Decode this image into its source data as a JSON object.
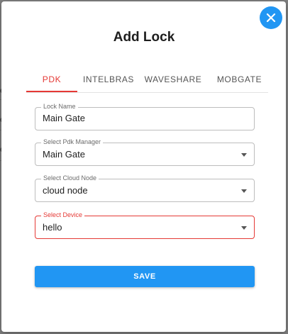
{
  "dialog": {
    "title": "Add Lock",
    "close_icon": "close-icon"
  },
  "background_fragments": [
    "e",
    "e",
    "e"
  ],
  "tabs": [
    {
      "label": "PDK",
      "active": true
    },
    {
      "label": "INTELBRAS",
      "active": false
    },
    {
      "label": "WAVESHARE",
      "active": false
    },
    {
      "label": "MOBGATE",
      "active": false
    }
  ],
  "form": {
    "lock_name": {
      "label": "Lock Name",
      "value": "Main Gate"
    },
    "pdk_manager": {
      "label": "Select Pdk Manager",
      "value": "Main Gate",
      "icon": "chevron-down-icon"
    },
    "cloud_node": {
      "label": "Select Cloud Node",
      "value": "cloud node",
      "icon": "chevron-down-icon"
    },
    "device": {
      "label": "Select Device",
      "value": "hello",
      "icon": "chevron-down-icon",
      "error": true
    }
  },
  "save_label": "SAVE",
  "colors": {
    "accent_blue": "#2196f3",
    "active_tab_red": "#e53935",
    "error_red": "#e53935"
  }
}
